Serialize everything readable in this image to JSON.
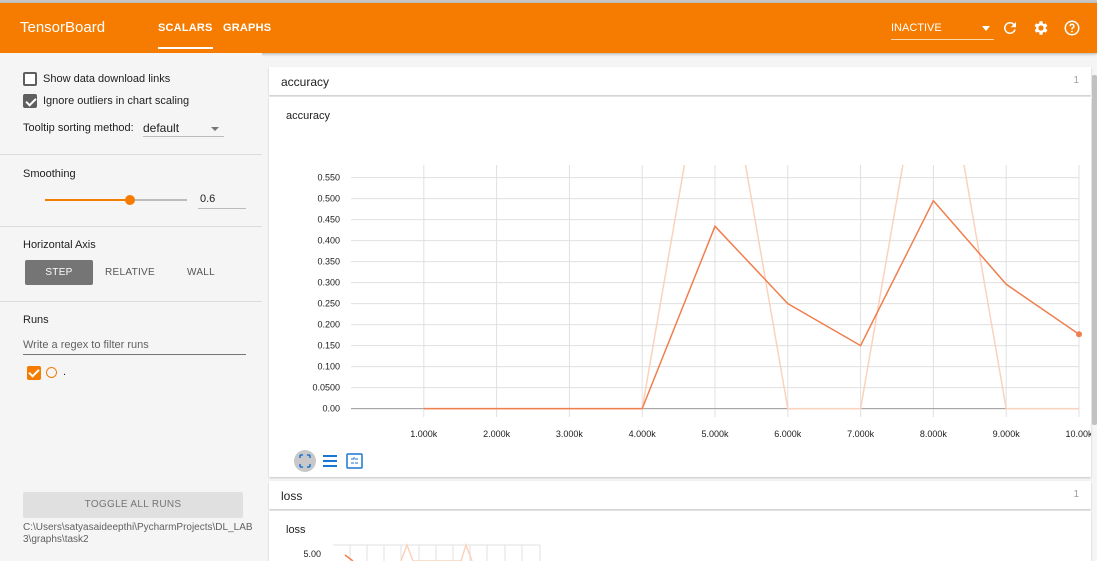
{
  "header": {
    "brand": "TensorBoard",
    "tabs": [
      {
        "label": "SCALARS"
      },
      {
        "label": "GRAPHS"
      }
    ],
    "status_select": "INACTIVE"
  },
  "sidebar": {
    "show_download_links": {
      "label": "Show data download links",
      "checked": false
    },
    "ignore_outliers": {
      "label": "Ignore outliers in chart scaling",
      "checked": true
    },
    "tooltip_sorting": {
      "label": "Tooltip sorting method:",
      "value": "default"
    },
    "smoothing": {
      "label": "Smoothing",
      "value": "0.6",
      "fraction": 0.6
    },
    "horizontal_axis": {
      "label": "Horizontal Axis",
      "options": [
        "STEP",
        "RELATIVE",
        "WALL"
      ],
      "selected": "STEP"
    },
    "runs": {
      "label": "Runs",
      "filter_placeholder": "Write a regex to filter runs",
      "items": [
        {
          "name": ".",
          "checked": true
        }
      ]
    },
    "toggle_all_runs": "TOGGLE ALL RUNS",
    "logdir": "C:\\Users\\satyasaideepthi\\PycharmProjects\\DL_LAB3\\graphs\\task2"
  },
  "main": {
    "accuracy_card": {
      "title": "accuracy",
      "count": "1",
      "chart_title": "accuracy"
    },
    "loss_card": {
      "title": "loss",
      "count": "1",
      "chart_title": "loss",
      "first_tick": "5.00"
    }
  },
  "colors": {
    "accent": "#f57c00",
    "raw_line": "#fbd2bd",
    "smoothed_line": "#f07f4f"
  },
  "chart_data": {
    "type": "line",
    "title": "accuracy",
    "xlabel": "",
    "ylabel": "",
    "x_ticks": [
      "1.000k",
      "2.000k",
      "3.000k",
      "4.000k",
      "5.000k",
      "6.000k",
      "7.000k",
      "8.000k",
      "9.000k",
      "10.00k"
    ],
    "y_ticks": [
      "0.00",
      "0.0500",
      "0.100",
      "0.150",
      "0.200",
      "0.250",
      "0.300",
      "0.350",
      "0.400",
      "0.450",
      "0.500",
      "0.550"
    ],
    "xlim": [
      0,
      10000
    ],
    "ylim": [
      -0.02,
      0.58
    ],
    "grid": true,
    "series": [
      {
        "role": "smoothed",
        "x": [
          1000,
          2000,
          3000,
          4000,
          5000,
          6000,
          7000,
          8000,
          9000,
          10000
        ],
        "y": [
          0.0,
          0.0,
          0.0,
          0.0,
          0.434,
          0.25,
          0.15,
          0.495,
          0.296,
          0.177
        ]
      },
      {
        "role": "raw",
        "x": [
          1000,
          2000,
          3000,
          4000,
          5000,
          6000,
          7000,
          8000,
          9000,
          10000
        ],
        "y": [
          0.0,
          0.0,
          0.0,
          0.0,
          1.0,
          0.0,
          0.0,
          1.0,
          0.0,
          0.0
        ]
      }
    ]
  }
}
